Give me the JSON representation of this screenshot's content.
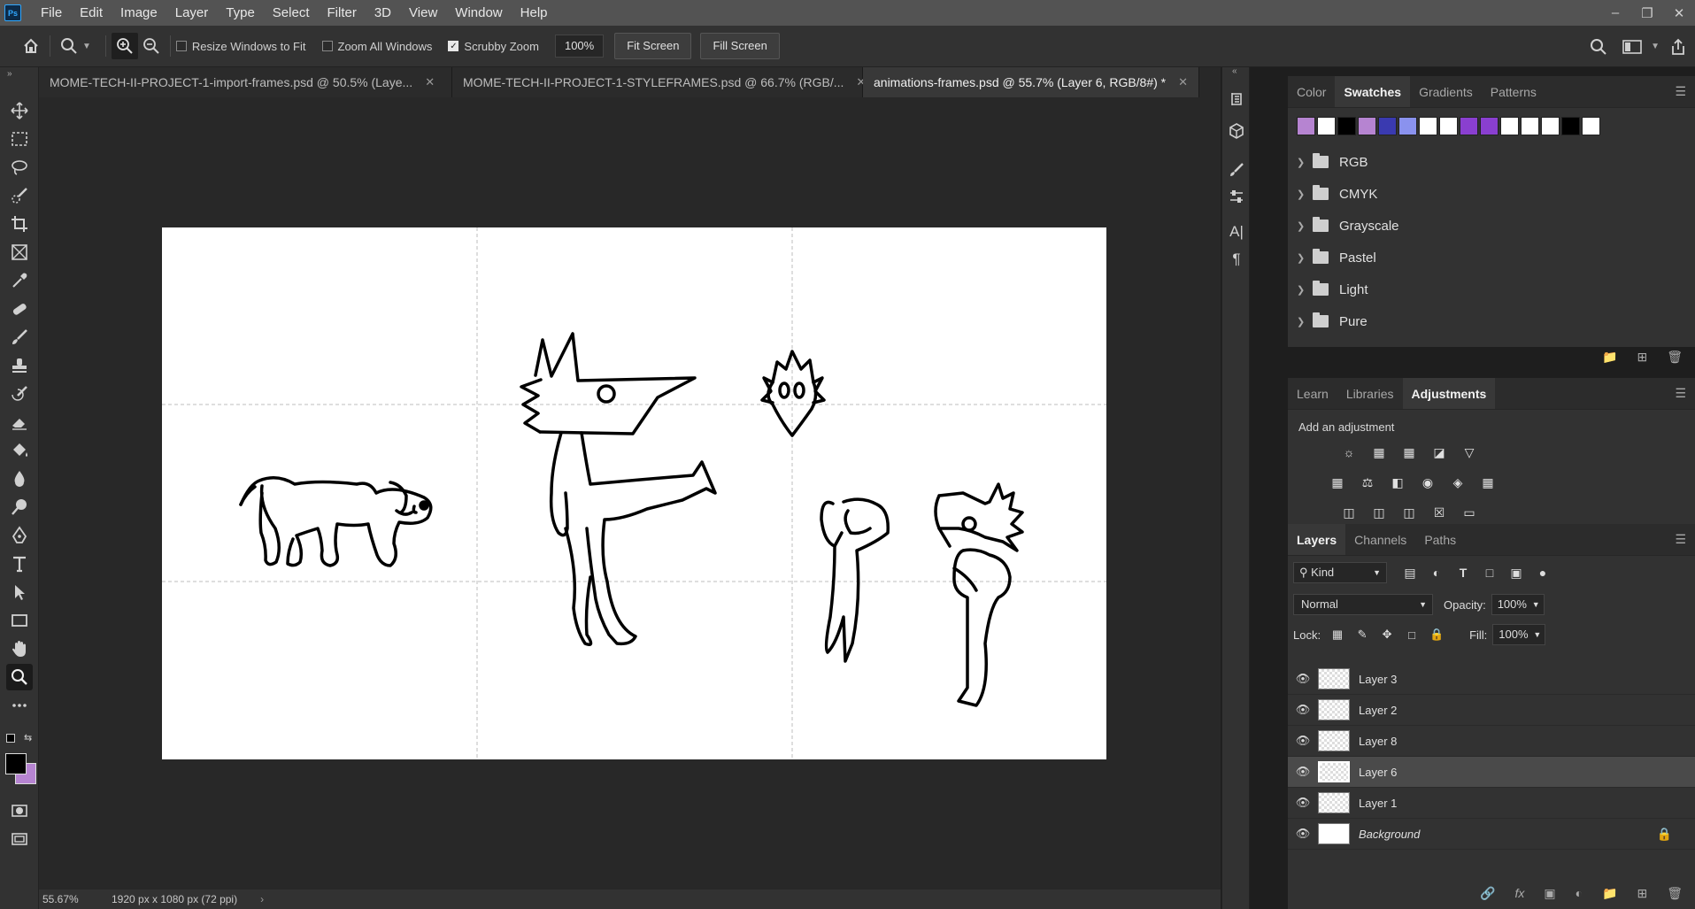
{
  "app": {
    "logo": "Ps"
  },
  "menu": [
    "File",
    "Edit",
    "Image",
    "Layer",
    "Type",
    "Select",
    "Filter",
    "3D",
    "View",
    "Window",
    "Help"
  ],
  "window_controls": [
    "minimize-icon",
    "restore-icon",
    "close-icon"
  ],
  "options": {
    "resize_windows": "Resize Windows to Fit",
    "resize_windows_checked": false,
    "zoom_all": "Zoom All Windows",
    "zoom_all_checked": false,
    "scrubby": "Scrubby Zoom",
    "scrubby_checked": true,
    "zoom_value": "100%",
    "fit_screen": "Fit Screen",
    "fill_screen": "Fill Screen"
  },
  "tabs": [
    {
      "label": "MOME-TECH-II-PROJECT-1-import-frames.psd @ 50.5% (Laye...",
      "active": false
    },
    {
      "label": "MOME-TECH-II-PROJECT-1-STYLEFRAMES.psd @ 66.7% (RGB/...",
      "active": false
    },
    {
      "label": "animations-frames.psd @ 55.7% (Layer 6, RGB/8#) *",
      "active": true
    }
  ],
  "status": {
    "zoom": "55.67%",
    "doc_info": "1920 px x 1080 px (72 ppi)"
  },
  "swatches_panel": {
    "tabs": [
      "Color",
      "Swatches",
      "Gradients",
      "Patterns"
    ],
    "active_tab": "Swatches",
    "colors": [
      "#b684d1",
      "#ffffff",
      "#000000",
      "#b684d1",
      "#3a3ab0",
      "#8a92ee",
      "#ffffff",
      "#ffffff",
      "#8a3fd0",
      "#8a3fd0",
      "#ffffff",
      "#ffffff",
      "#ffffff",
      "#000000",
      "#ffffff"
    ],
    "folders": [
      "RGB",
      "CMYK",
      "Grayscale",
      "Pastel",
      "Light",
      "Pure"
    ]
  },
  "adjustments_panel": {
    "tabs": [
      "Learn",
      "Libraries",
      "Adjustments"
    ],
    "active_tab": "Adjustments",
    "title": "Add an adjustment"
  },
  "layers_panel": {
    "tabs": [
      "Layers",
      "Channels",
      "Paths"
    ],
    "active_tab": "Layers",
    "kind": "Kind",
    "blend_mode": "Normal",
    "opacity_label": "Opacity:",
    "opacity": "100%",
    "lock_label": "Lock:",
    "fill_label": "Fill:",
    "fill": "100%",
    "layers": [
      {
        "name": "Layer 3",
        "selected": false
      },
      {
        "name": "Layer 2",
        "selected": false
      },
      {
        "name": "Layer 8",
        "selected": false
      },
      {
        "name": "Layer 6",
        "selected": true
      },
      {
        "name": "Layer 1",
        "selected": false
      },
      {
        "name": "Background",
        "selected": false
      }
    ]
  }
}
